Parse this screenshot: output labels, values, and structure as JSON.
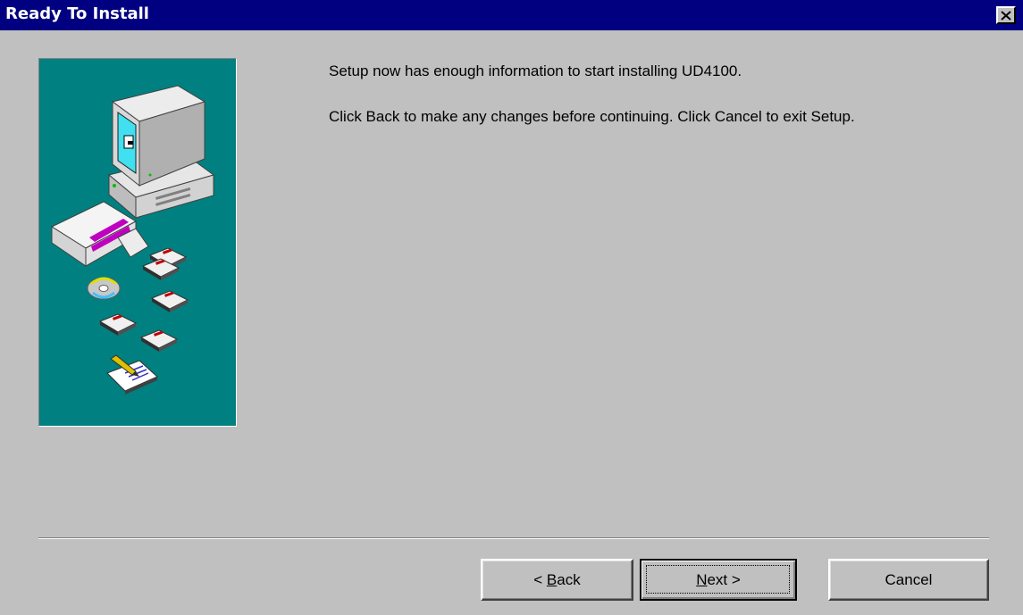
{
  "window": {
    "title": "Ready To Install",
    "colors": {
      "titlebar": "#000080",
      "face": "#c0c0c0",
      "illustration_bg": "#008080"
    },
    "close_icon": "close-x-icon"
  },
  "content": {
    "line1": "Setup now has enough information to start installing UD4100.",
    "line2": "Click Back to make any changes before continuing. Click Cancel to exit Setup."
  },
  "illustration": {
    "icons": [
      "computer-icon",
      "software-box-icon",
      "cd-icon",
      "floppy-disk-icon",
      "pencil-paper-icon"
    ]
  },
  "buttons": {
    "back": {
      "prefix": "< ",
      "accel": "B",
      "rest": "ack"
    },
    "next": {
      "accel": "N",
      "rest": "ext >"
    },
    "cancel": {
      "label": "Cancel"
    }
  }
}
